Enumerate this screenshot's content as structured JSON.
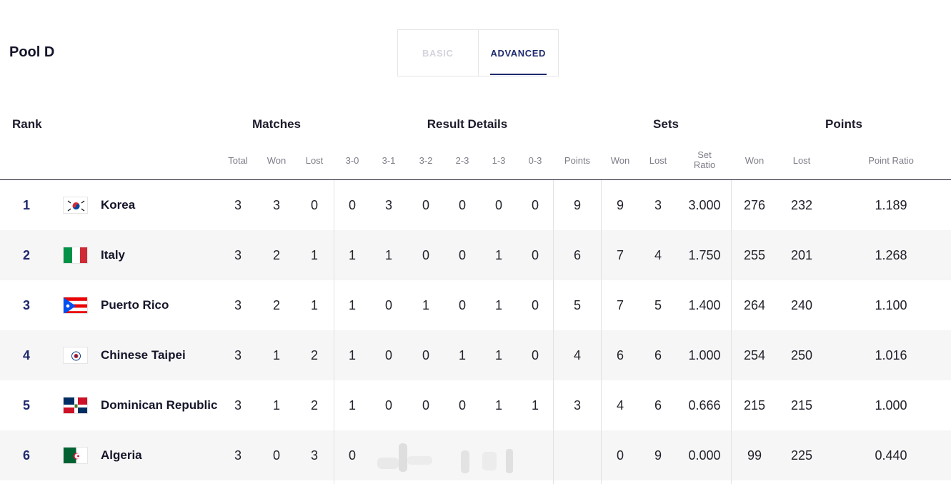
{
  "pool": {
    "title": "Pool D"
  },
  "tabs": [
    {
      "label": "BASIC",
      "active": false
    },
    {
      "label": "ADVANCED",
      "active": true
    }
  ],
  "groups": {
    "rank": "Rank",
    "matches": "Matches",
    "result_details": "Result Details",
    "sets": "Sets",
    "points": "Points"
  },
  "subheaders": {
    "total": "Total",
    "won": "Won",
    "lost": "Lost",
    "r30": "3-0",
    "r31": "3-1",
    "r32": "3-2",
    "r23": "2-3",
    "r13": "1-3",
    "r03": "0-3",
    "points": "Points",
    "sets_won": "Won",
    "sets_lost": "Lost",
    "set_ratio_line1": "Set",
    "set_ratio_line2": "Ratio",
    "pts_won": "Won",
    "pts_lost": "Lost",
    "point_ratio": "Point Ratio"
  },
  "colors": {
    "accent": "#1f2a6e",
    "alt_row": "#f6f6f6"
  },
  "rows": [
    {
      "rank": "1",
      "team": "Korea",
      "flag": "korea-flag-icon",
      "total": "3",
      "won": "3",
      "lost": "0",
      "r30": "0",
      "r31": "3",
      "r32": "0",
      "r23": "0",
      "r13": "0",
      "r03": "0",
      "points": "9",
      "sets_won": "9",
      "sets_lost": "3",
      "set_ratio": "3.000",
      "pts_won": "276",
      "pts_lost": "232",
      "point_ratio": "1.189"
    },
    {
      "rank": "2",
      "team": "Italy",
      "flag": "italy-flag-icon",
      "total": "3",
      "won": "2",
      "lost": "1",
      "r30": "1",
      "r31": "1",
      "r32": "0",
      "r23": "0",
      "r13": "1",
      "r03": "0",
      "points": "6",
      "sets_won": "7",
      "sets_lost": "4",
      "set_ratio": "1.750",
      "pts_won": "255",
      "pts_lost": "201",
      "point_ratio": "1.268"
    },
    {
      "rank": "3",
      "team": "Puerto Rico",
      "flag": "puerto-rico-flag-icon",
      "total": "3",
      "won": "2",
      "lost": "1",
      "r30": "1",
      "r31": "0",
      "r32": "1",
      "r23": "0",
      "r13": "1",
      "r03": "0",
      "points": "5",
      "sets_won": "7",
      "sets_lost": "5",
      "set_ratio": "1.400",
      "pts_won": "264",
      "pts_lost": "240",
      "point_ratio": "1.100"
    },
    {
      "rank": "4",
      "team": "Chinese Taipei",
      "flag": "chinese-taipei-flag-icon",
      "total": "3",
      "won": "1",
      "lost": "2",
      "r30": "1",
      "r31": "0",
      "r32": "0",
      "r23": "1",
      "r13": "1",
      "r03": "0",
      "points": "4",
      "sets_won": "6",
      "sets_lost": "6",
      "set_ratio": "1.000",
      "pts_won": "254",
      "pts_lost": "250",
      "point_ratio": "1.016"
    },
    {
      "rank": "5",
      "team": "Dominican Republic",
      "flag": "dominican-republic-flag-icon",
      "total": "3",
      "won": "1",
      "lost": "2",
      "r30": "1",
      "r31": "0",
      "r32": "0",
      "r23": "0",
      "r13": "1",
      "r03": "1",
      "points": "3",
      "sets_won": "4",
      "sets_lost": "6",
      "set_ratio": "0.666",
      "pts_won": "215",
      "pts_lost": "215",
      "point_ratio": "1.000"
    },
    {
      "rank": "6",
      "team": "Algeria",
      "flag": "algeria-flag-icon",
      "total": "3",
      "won": "0",
      "lost": "3",
      "r30": "0",
      "r31": "",
      "r32": "",
      "r23": "",
      "r13": "",
      "r03": "",
      "points": "",
      "sets_won": "0",
      "sets_lost": "9",
      "set_ratio": "0.000",
      "pts_won": "99",
      "pts_lost": "225",
      "point_ratio": "0.440"
    }
  ]
}
